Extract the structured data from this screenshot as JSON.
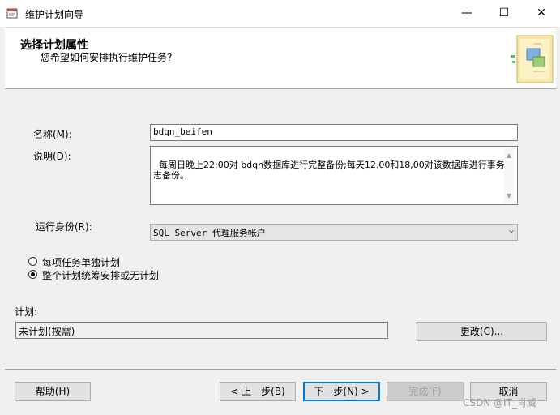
{
  "window": {
    "title": "维护计划向导",
    "minimize_glyph": "—",
    "maximize_glyph": "☐",
    "close_glyph": "✕"
  },
  "header": {
    "title": "选择计划属性",
    "subtitle": "您希望如何安排执行维护任务?"
  },
  "form": {
    "name_label": "名称(M):",
    "name_value": "bdqn_beifen",
    "description_label": "说明(D):",
    "description_value": "每周日晚上22:00对 bdqn数据库进行完整备份;每天12.00和18,00对该数据库进行事务日志备份。",
    "run_as_label": "运行身份(R):",
    "run_as_value": "SQL Server 代理服务帐户"
  },
  "schedule_options": {
    "option_separate": "每项任务单独计划",
    "option_single": "整个计划统筹安排或无计划",
    "selected": "option_single"
  },
  "schedule": {
    "label": "计划:",
    "value": "未计划(按需)",
    "change_button": "更改(C)..."
  },
  "footer": {
    "help": "帮助(H)",
    "back": "< 上一步(B)",
    "next": "下一步(N) >",
    "finish": "完成(F)",
    "cancel": "取消"
  },
  "watermark": "CSDN @IT_肖威",
  "icons": [
    "app-maintenance-icon",
    "wizard-illustration-icon",
    "chevron-down-icon",
    "scroll-up-icon",
    "scroll-down-icon"
  ]
}
